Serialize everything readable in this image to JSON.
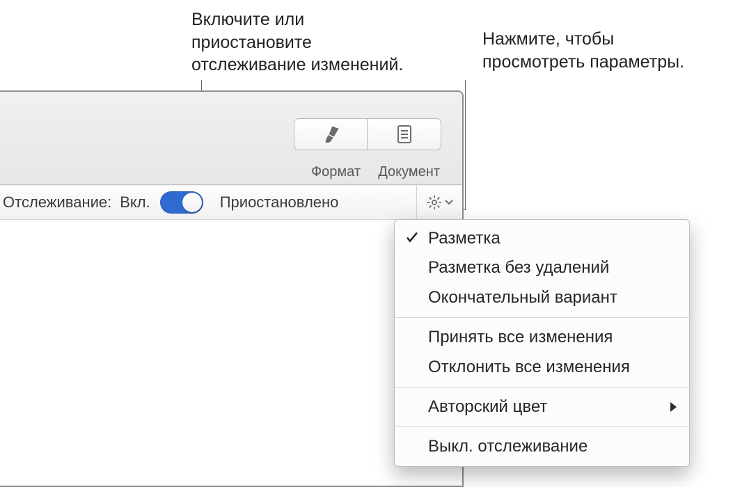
{
  "callouts": {
    "left": "Включите или\nприостановите\nотслеживание изменений.",
    "right": "Нажмите, чтобы\nпросмотреть параметры."
  },
  "toolbar": {
    "format_label": "Формат",
    "document_label": "Документ"
  },
  "trackbar": {
    "label": "Отслеживание:",
    "on": "Вкл.",
    "paused": "Приостановлено"
  },
  "menu": {
    "items": [
      {
        "label": "Разметка",
        "checked": true
      },
      {
        "label": "Разметка без удалений"
      },
      {
        "label": "Окончательный вариант"
      }
    ],
    "items2": [
      {
        "label": "Принять все изменения"
      },
      {
        "label": "Отклонить все изменения"
      }
    ],
    "items3": [
      {
        "label": "Авторский цвет",
        "submenu": true
      }
    ],
    "items4": [
      {
        "label": "Выкл. отслеживание"
      }
    ]
  }
}
